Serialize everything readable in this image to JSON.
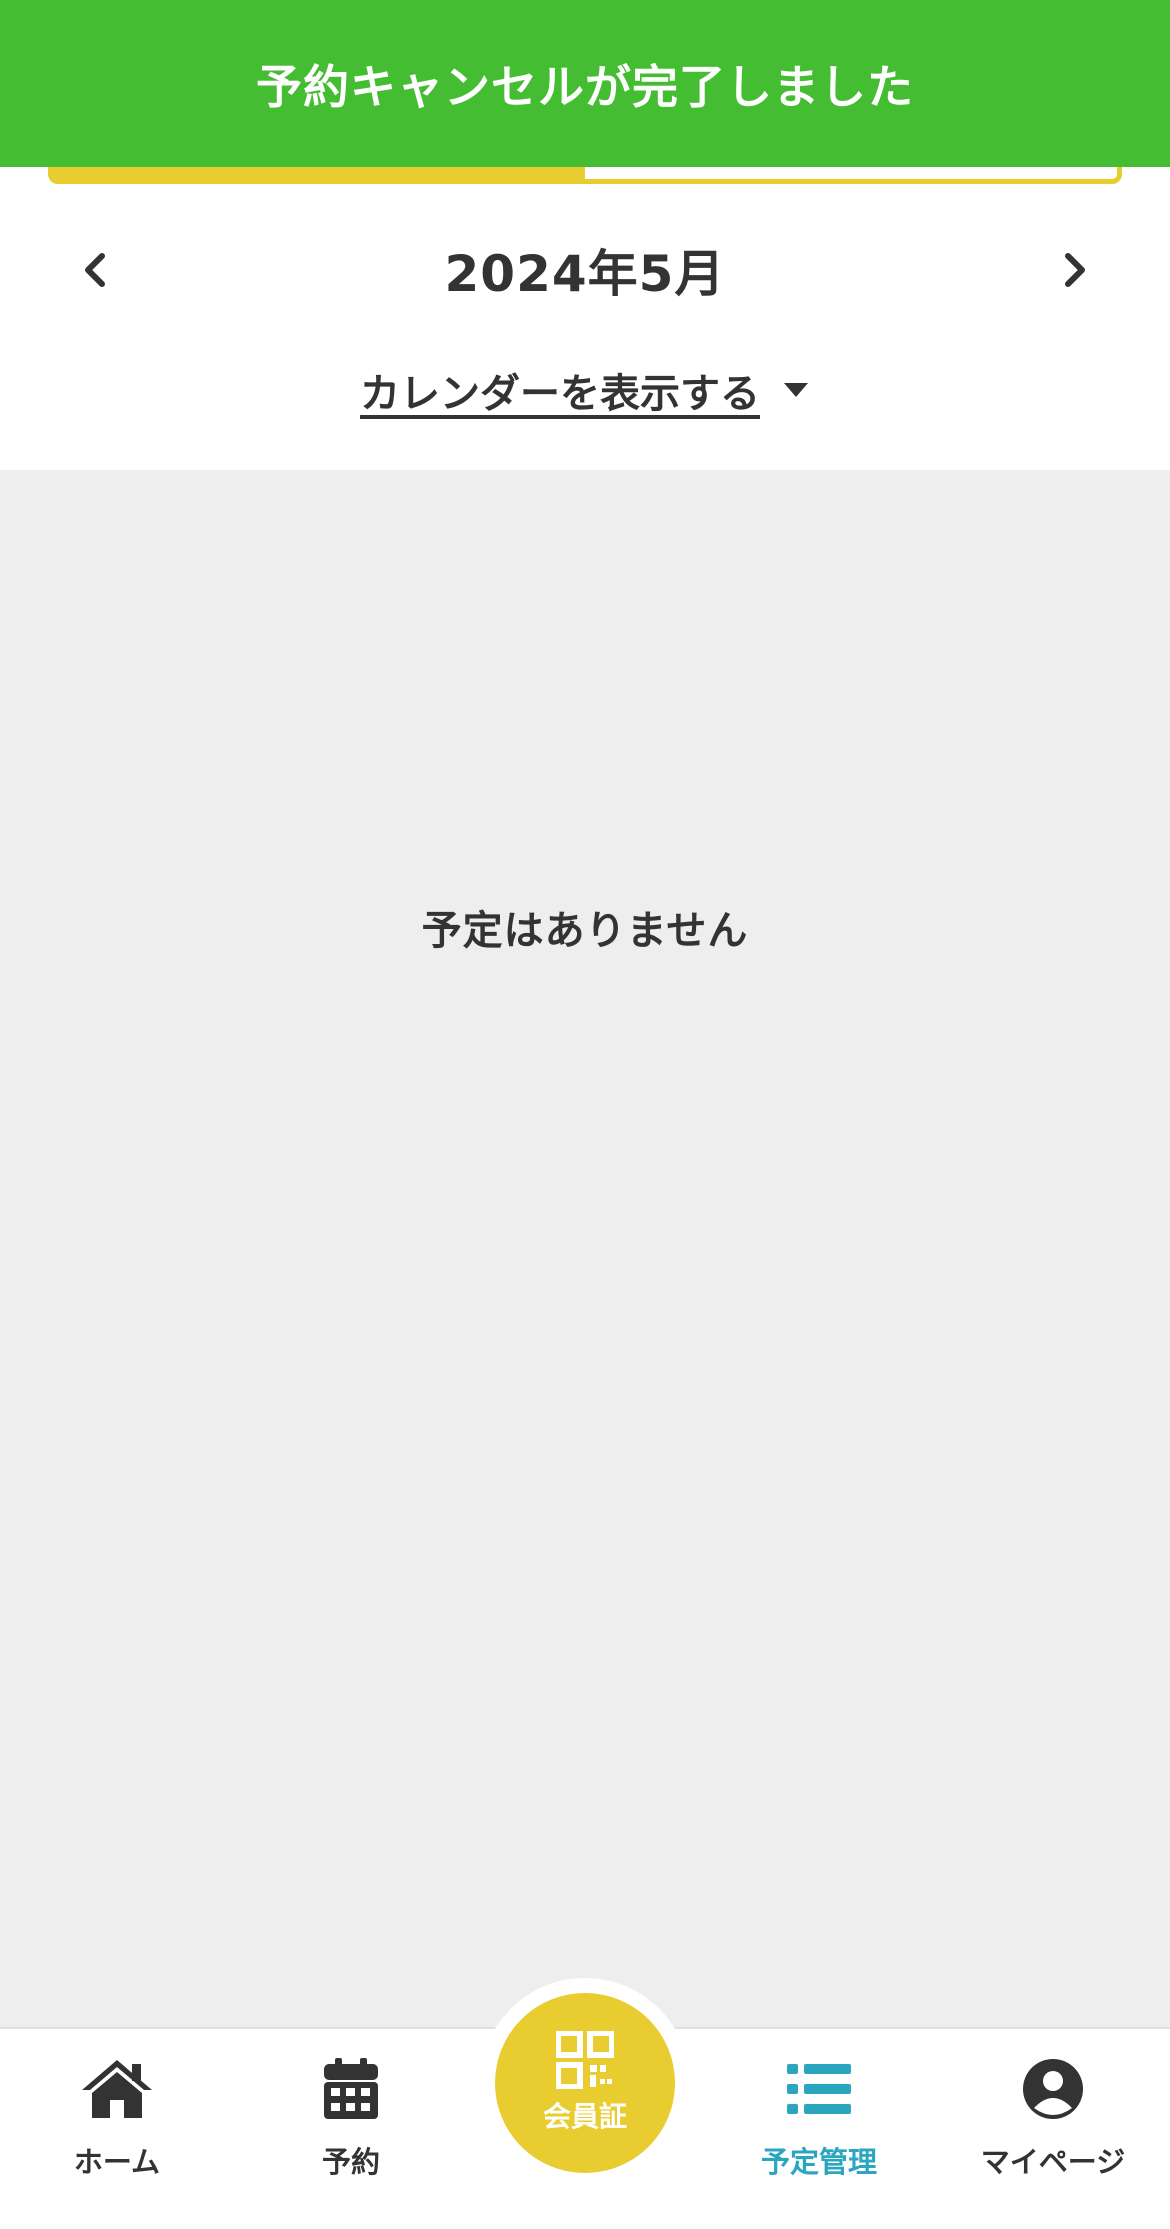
{
  "toast": {
    "message": "予約キャンセルが完了しました",
    "color": "#45bd32"
  },
  "tabs": [
    {
      "label": "",
      "active": true
    },
    {
      "label": "",
      "active": false
    }
  ],
  "month_nav": {
    "title": "2024年5月",
    "prev_icon": "chevron-left-icon",
    "next_icon": "chevron-right-icon"
  },
  "calendar_toggle": {
    "label": "カレンダーを表示する",
    "icon": "caret-down-icon"
  },
  "empty_state": {
    "message": "予定はありません"
  },
  "bottom_nav": {
    "items": [
      {
        "label": "ホーム",
        "icon": "home-icon",
        "active": false
      },
      {
        "label": "予約",
        "icon": "calendar-icon",
        "active": false
      },
      {
        "label": "会員証",
        "icon": "qr-code-icon",
        "active": false
      },
      {
        "label": "予定管理",
        "icon": "list-icon",
        "active": true
      },
      {
        "label": "マイページ",
        "icon": "user-circle-icon",
        "active": false
      }
    ]
  },
  "colors": {
    "accent_yellow": "#e9cc2f",
    "active_blue": "#2aa6bf",
    "text": "#333333",
    "background_gray": "#eeeeee"
  }
}
